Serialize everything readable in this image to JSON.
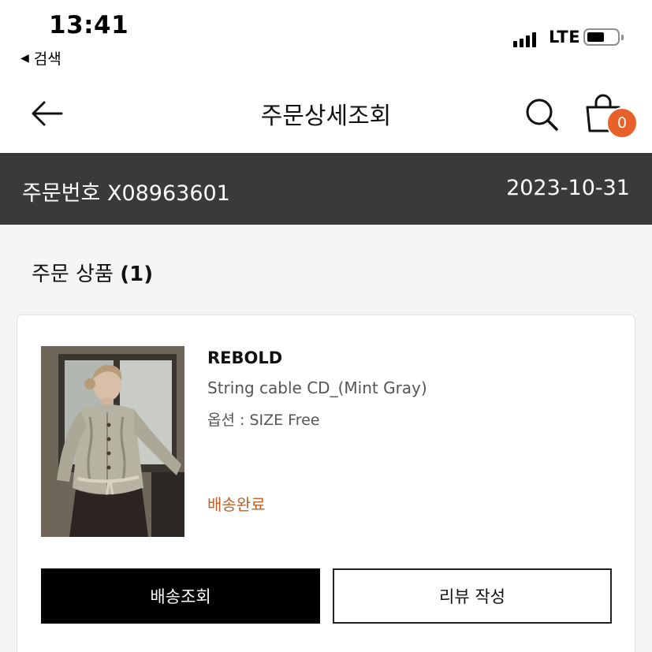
{
  "status_bar": {
    "time": "13:41",
    "back_app": "검색",
    "back_icon": "◀",
    "network": "LTE"
  },
  "header": {
    "title": "주문상세조회",
    "cart_count": "0",
    "accent_color": "#e8612a"
  },
  "order": {
    "number_label": "주문번호 X08963601",
    "date": "2023-10-31"
  },
  "section": {
    "title": "주문 상품",
    "count": "(1)"
  },
  "product": {
    "brand": "REBOLD",
    "name": "String cable CD_(Mint Gray)",
    "option": "옵션 : SIZE Free",
    "status": "배송완료",
    "status_color": "#c0612a"
  },
  "actions": {
    "track_label": "배송조회",
    "review_label": "리뷰 작성"
  }
}
